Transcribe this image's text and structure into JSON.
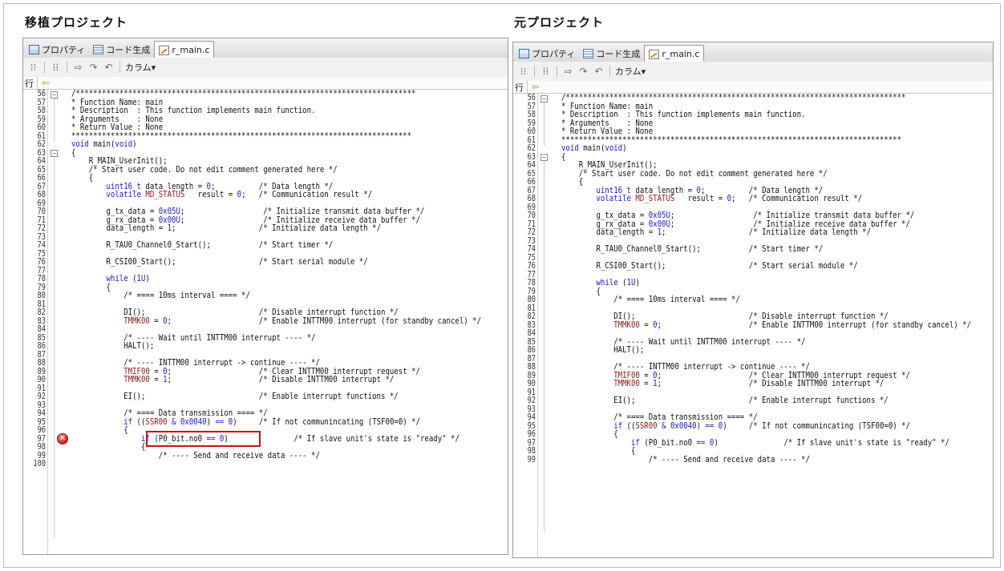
{
  "left_panel": {
    "title": "移植プロジェクト",
    "tabs": [
      {
        "label": "プロパティ",
        "icon": "property-icon"
      },
      {
        "label": "コード生成",
        "icon": "code-generation-icon"
      },
      {
        "label": "r_main.c",
        "icon": "c-file-icon"
      }
    ],
    "toolbar_menu": "カラム▾",
    "gutter_header": "行",
    "error_marker_line": "97"
  },
  "right_panel": {
    "title": "元プロジェクト",
    "tabs": [
      {
        "label": "プロパティ",
        "icon": "property-icon"
      },
      {
        "label": "コード生成",
        "icon": "code-generation-icon"
      },
      {
        "label": "r_main.c",
        "icon": "c-file-icon"
      }
    ],
    "toolbar_menu": "カラム▾",
    "gutter_header": "行"
  },
  "colors": {
    "keyword": "#1a1ac9",
    "error": "#d12a2a",
    "highlight": "#c41414"
  },
  "code_lines": [
    {
      "n": "56",
      "t": "/******************************************************************************"
    },
    {
      "n": "57",
      "t": "* Function Name: main"
    },
    {
      "n": "58",
      "t": "* Description  : This function implements main function."
    },
    {
      "n": "59",
      "t": "* Arguments    : None"
    },
    {
      "n": "60",
      "t": "* Return Value : None"
    },
    {
      "n": "61",
      "t": "******************************************************************************"
    },
    {
      "n": "62",
      "t": "void main(void)"
    },
    {
      "n": "63",
      "t": "{"
    },
    {
      "n": "64",
      "t": "    R_MAIN_UserInit();"
    },
    {
      "n": "65",
      "t": "    /* Start user code. Do not edit comment generated here */"
    },
    {
      "n": "66",
      "t": "    {"
    },
    {
      "n": "67",
      "t": "        uint16_t data_length = 0;          /* Data length */"
    },
    {
      "n": "68",
      "t": "        volatile MD_STATUS   result = 0;   /* Communication result */"
    },
    {
      "n": "69",
      "t": ""
    },
    {
      "n": "70",
      "t": "        g_tx_data = 0x05U;                  /* Initialize transmit data buffer */"
    },
    {
      "n": "71",
      "t": "        g_rx_data = 0x00U;                  /* Initialize receive data buffer */"
    },
    {
      "n": "72",
      "t": "        data_length = 1;                   /* Initialize data length */"
    },
    {
      "n": "73",
      "t": ""
    },
    {
      "n": "74",
      "t": "        R_TAU0_Channel0_Start();           /* Start timer */"
    },
    {
      "n": "75",
      "t": ""
    },
    {
      "n": "76",
      "t": "        R_CSI00_Start();                   /* Start serial module */"
    },
    {
      "n": "77",
      "t": ""
    },
    {
      "n": "78",
      "t": "        while (1U)"
    },
    {
      "n": "79",
      "t": "        {"
    },
    {
      "n": "80",
      "t": "            /* ==== 10ms interval ==== */"
    },
    {
      "n": "81",
      "t": ""
    },
    {
      "n": "82",
      "t": "            DI();                          /* Disable interrupt function */"
    },
    {
      "n": "83",
      "t": "            TMMK00 = 0;                    /* Enable INTTM00 interrupt (for standby cancel) */"
    },
    {
      "n": "84",
      "t": ""
    },
    {
      "n": "85",
      "t": "            /* ---- Wait until INTTM00 interrupt ---- */"
    },
    {
      "n": "86",
      "t": "            HALT();"
    },
    {
      "n": "87",
      "t": ""
    },
    {
      "n": "88",
      "t": "            /* ---- INTTM00 interrupt -> continue ---- */"
    },
    {
      "n": "89",
      "t": "            TMIF00 = 0;                    /* Clear INTTM00 interrupt request */"
    },
    {
      "n": "90",
      "t": "            TMMK00 = 1;                    /* Disable INTTM00 interrupt */"
    },
    {
      "n": "91",
      "t": ""
    },
    {
      "n": "92",
      "t": "            EI();                          /* Enable interrupt functions */"
    },
    {
      "n": "93",
      "t": ""
    },
    {
      "n": "94",
      "t": "            /* ==== Data transmission ==== */"
    },
    {
      "n": "95",
      "t": "            if ((SSR00 & 0x0040) == 0)     /* If not communincating (TSF00=0) */"
    },
    {
      "n": "96",
      "t": "            {"
    },
    {
      "n": "97",
      "t": "                if (P0_bit.no0 == 0)               /* If slave unit's state is \"ready\" */"
    },
    {
      "n": "98",
      "t": "                {"
    },
    {
      "n": "99",
      "t": "                    /* ---- Send and receive data ---- */"
    },
    {
      "n": "100",
      "t": ""
    }
  ]
}
